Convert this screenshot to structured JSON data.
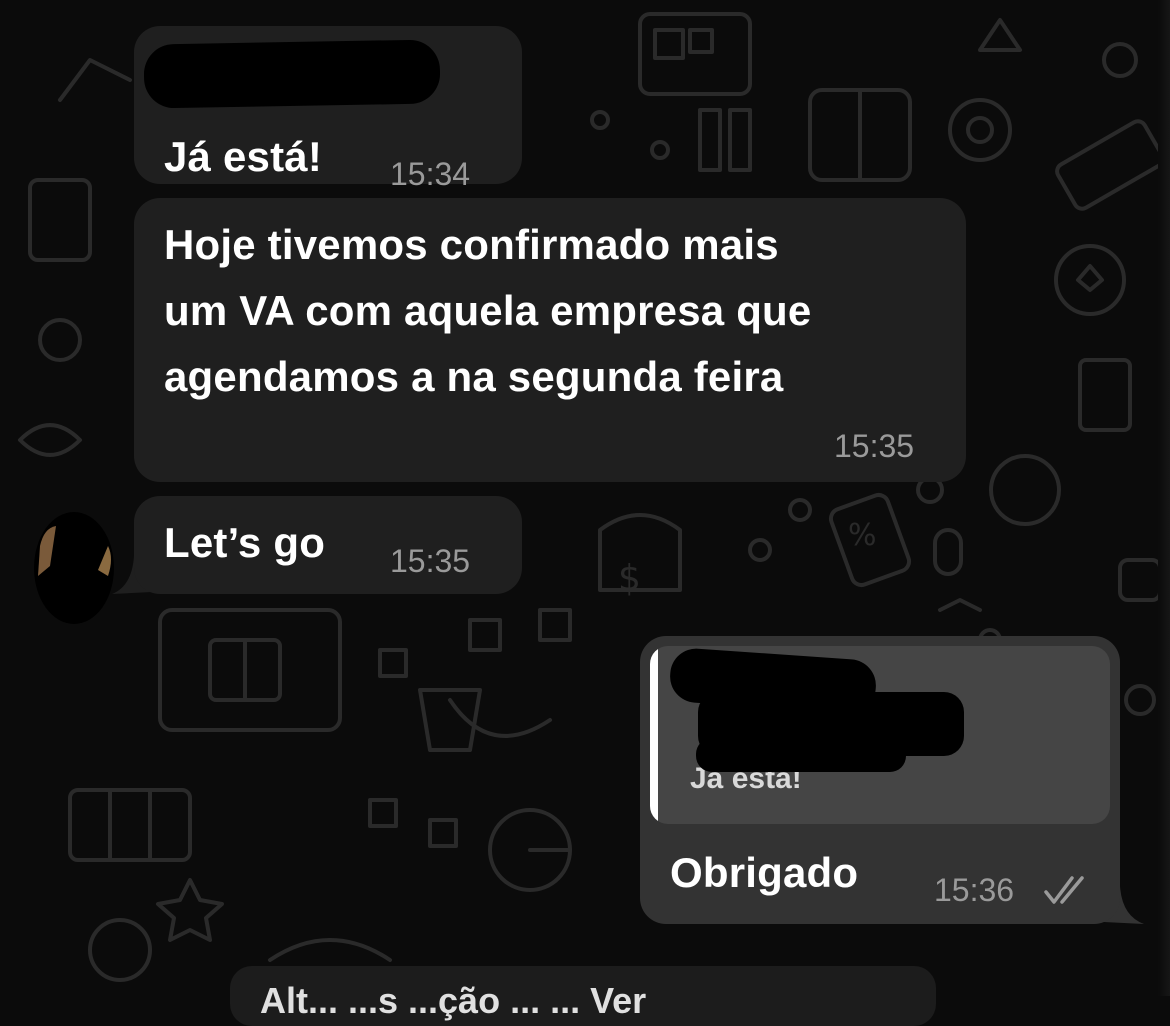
{
  "colors": {
    "background": "#0b0b0b",
    "incoming_bubble": "#1f1f1f",
    "outgoing_bubble": "#333333",
    "quote_box": "#454545",
    "timestamp": "#9a9a9a",
    "text": "#ffffff"
  },
  "messages": [
    {
      "direction": "incoming",
      "sender_redacted": true,
      "text": "Já está!",
      "time": "15:34"
    },
    {
      "direction": "incoming",
      "lines": [
        "Hoje tivemos confirmado mais",
        "um VA com aquela empresa que",
        "agendamos a na segunda feira"
      ],
      "time": "15:35"
    },
    {
      "direction": "incoming",
      "text": "Let’s go",
      "time": "15:35",
      "avatar": "avatar"
    },
    {
      "direction": "outgoing",
      "quoted": {
        "sender_redacted": true,
        "text": "Já está!"
      },
      "text": "Obrigado",
      "time": "15:36",
      "status_icon": "double-check-icon"
    }
  ],
  "system_banner": {
    "text": "Alt... ...s ...ção ... ... Ver"
  }
}
